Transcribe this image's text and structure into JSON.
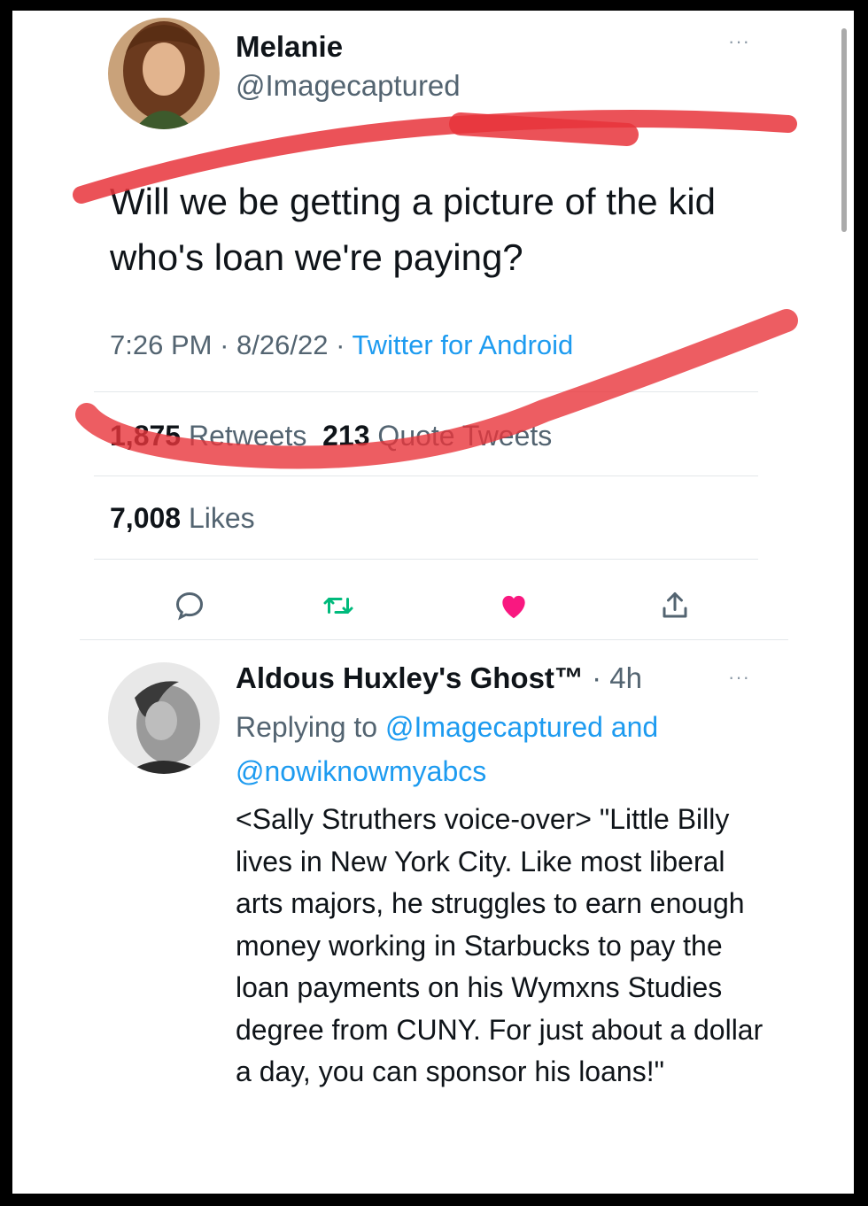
{
  "tweet": {
    "author_name": "Melanie",
    "author_handle": "@Imagecaptured",
    "more_label": "···",
    "text": "Will we be getting a picture of the kid who's loan we're paying?",
    "time": "7:26 PM",
    "sep1": " · ",
    "date": "8/26/22",
    "sep2": " · ",
    "source": "Twitter for Android",
    "retweets_count": "1,875",
    "retweets_label": "Retweets",
    "quotes_count": "213",
    "quotes_label": "Quote Tweets",
    "likes_count": "7,008",
    "likes_label": "Likes"
  },
  "actions": {
    "reply_icon": "reply-icon",
    "retweet_icon": "retweet-icon",
    "like_icon": "heart-icon",
    "share_icon": "share-icon",
    "like_color": "#f91880",
    "retweet_color": "#00ba7c"
  },
  "reply": {
    "author_name": "Aldous Huxley's Ghost™",
    "dot": " · ",
    "time": "4h",
    "more_label": "···",
    "replying_prefix": "Replying to ",
    "mention1": "@Imagecaptured",
    "and_word": " and",
    "mention2": "@nowiknowmyabcs",
    "text": "<Sally Struthers voice-over> \"Little Billy lives in New York City. Like most liberal arts majors, he struggles to earn enough money working in Starbucks to pay the loan payments on his Wymxns Studies degree from CUNY. For just about a dollar a day, you can sponsor his loans!\""
  },
  "colors": {
    "accent": "#1d9bf0",
    "markup": "#e8343b"
  }
}
